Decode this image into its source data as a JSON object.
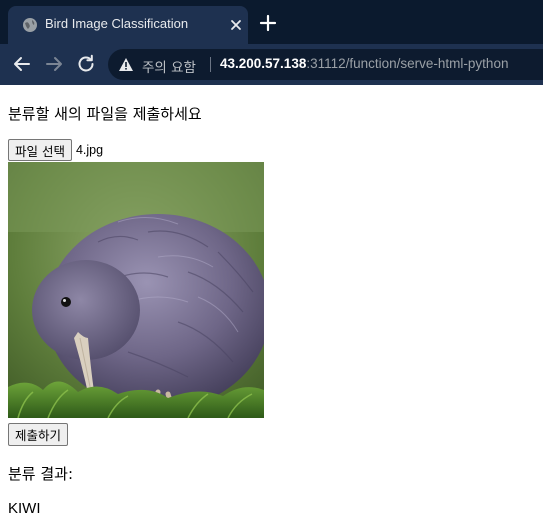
{
  "browser": {
    "tab": {
      "title": "Bird Image Classification",
      "favicon": "globe-icon"
    },
    "new_tab_icon": "plus-icon",
    "nav": {
      "back_icon": "back-arrow-icon",
      "forward_icon": "forward-arrow-icon",
      "reload_icon": "reload-icon"
    },
    "omnibox": {
      "security_icon": "warning-triangle-icon",
      "security_text": "주의 요함",
      "url_host": "43.200.57.138",
      "url_rest": ":31112/function/serve-html-python"
    }
  },
  "page": {
    "heading": "분류할 새의 파일을 제출하세요",
    "file_input": {
      "button_label": "파일 선택",
      "file_name": "4.jpg"
    },
    "preview_image": "kiwi-bird-photo",
    "submit_label": "제출하기",
    "result_label": "분류 결과:",
    "result_value": "KIWI"
  },
  "colors": {
    "tabbar_bg": "#0b1a2e",
    "toolbar_bg": "#1e3150",
    "omnibox_bg": "#0d1b2f",
    "page_bg": "#ffffff"
  }
}
